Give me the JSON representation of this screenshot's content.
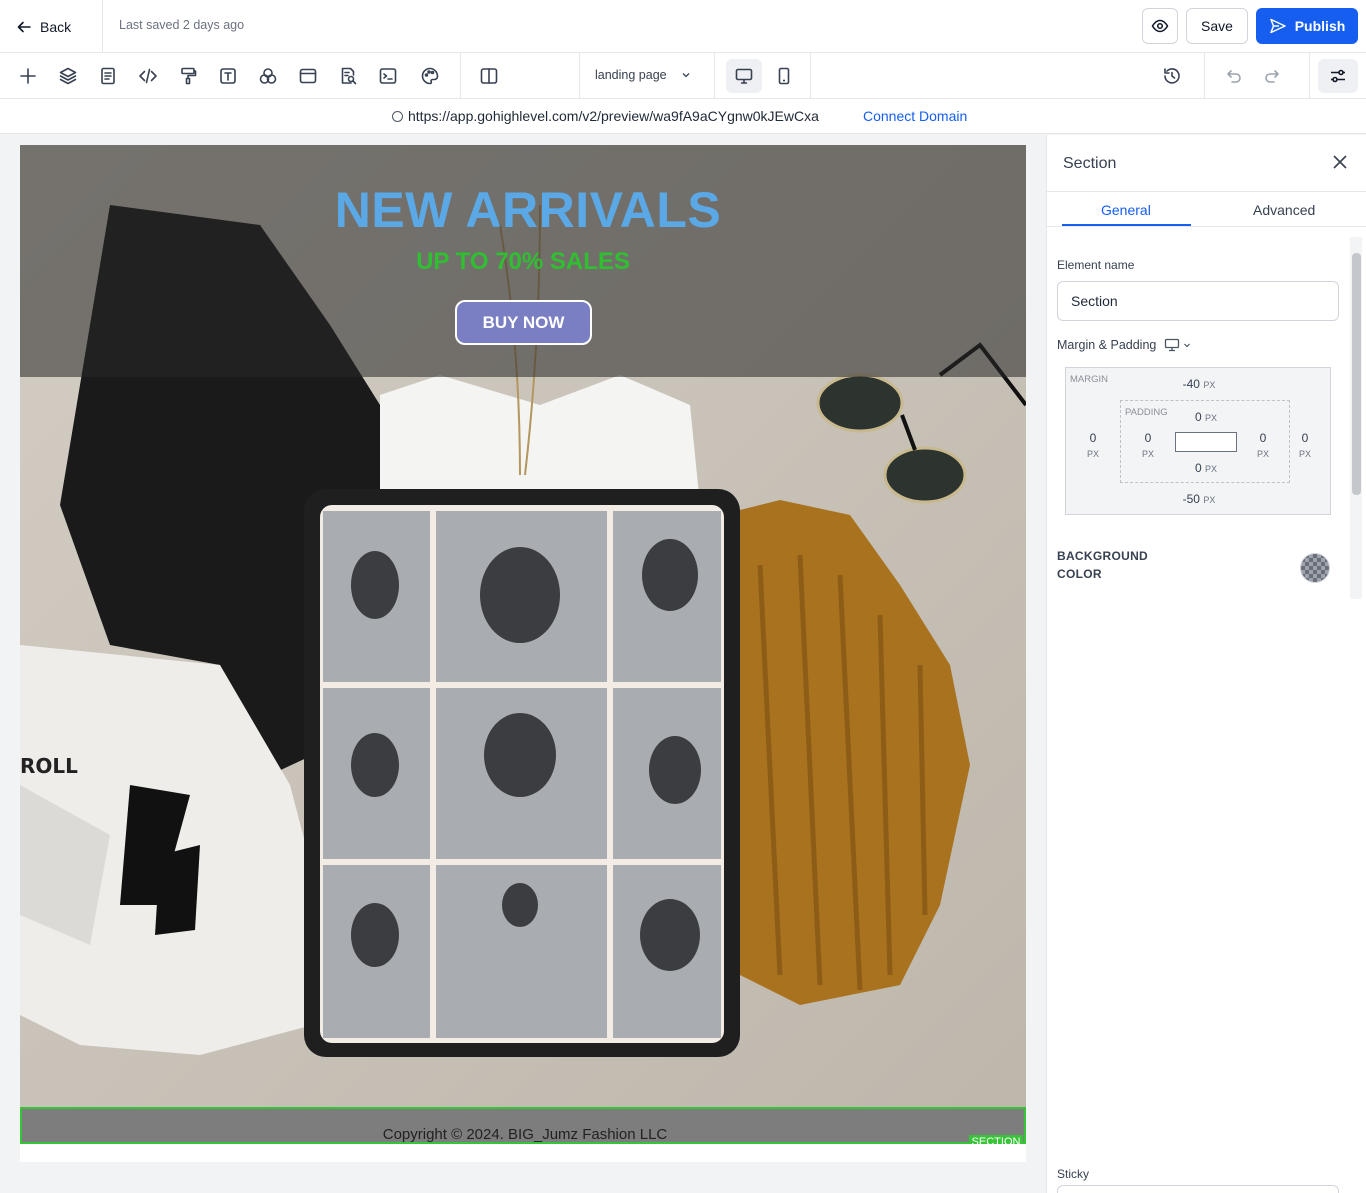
{
  "header": {
    "back_label": "Back",
    "last_saved": "Last saved 2 days ago",
    "save_label": "Save",
    "publish_label": "Publish",
    "accent_color": "#155eef"
  },
  "toolbar": {
    "icons": [
      "plus-icon",
      "layers-icon",
      "page-icon",
      "code-icon",
      "paint-roller-icon",
      "text-icon",
      "shapes-icon",
      "browser-window-icon",
      "search-document-icon",
      "terminal-icon",
      "palette-icon",
      "columns-icon"
    ],
    "page_select": "landing page",
    "devices": [
      "desktop-icon",
      "mobile-icon"
    ],
    "history_icon": "history-icon",
    "undo_icon": "undo-icon",
    "redo_icon": "redo-icon",
    "settings_icon": "sliders-icon"
  },
  "urlbar": {
    "url": "https://app.gohighlevel.com/v2/preview/wa9fA9aCYgnw0kJEwCxa",
    "connect_label": "Connect Domain"
  },
  "canvas": {
    "hero_title": "NEW ARRIVALS",
    "hero_subtitle": "UP TO 70% SALES",
    "buy_button": "BUY NOW",
    "footer_text": "Copyright © 2024. BIG_Jumz Fashion LLC",
    "section_tag": "SECTION",
    "title_color": "#5aa8e6",
    "subtitle_color": "#2fbf31",
    "button_color": "#7a7fc4",
    "selection_color": "#37c437"
  },
  "panel": {
    "title": "Section",
    "tabs": [
      "General",
      "Advanced"
    ],
    "element_name_label": "Element name",
    "element_name_value": "Section",
    "margin_padding_label": "Margin & Padding",
    "margin_label": "MARGIN",
    "padding_label": "PADDING",
    "unit": "PX",
    "margin": {
      "top": "-40",
      "right": "0",
      "bottom": "-50",
      "left": "0"
    },
    "padding": {
      "top": "0",
      "right": "0",
      "bottom": "0",
      "left": "0"
    },
    "background_label": "BACKGROUND COLOR",
    "sticky_label": "Sticky"
  }
}
